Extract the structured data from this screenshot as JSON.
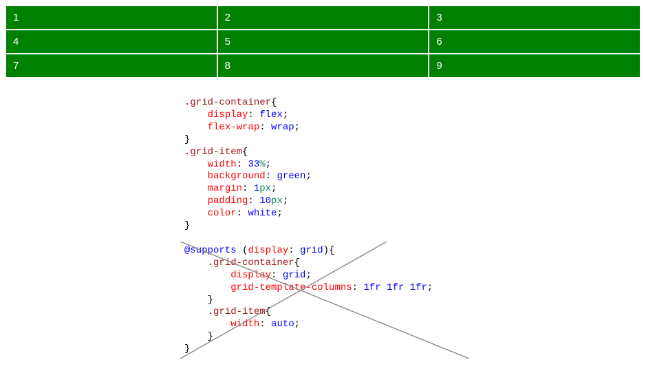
{
  "grid": {
    "cells": [
      "1",
      "2",
      "3",
      "4",
      "5",
      "6",
      "7",
      "8",
      "9"
    ]
  },
  "code": {
    "l1_sel": ".grid-container",
    "l1_t": "{",
    "l2_p": "display",
    "l2_v": "flex",
    "l3_p": "flex-wrap",
    "l3_v": "wrap",
    "l4_t": "}",
    "l5_sel": ".grid-item",
    "l5_t": "{",
    "l6_p": "width",
    "l6_n": "33",
    "l6_u": "%",
    "l7_p": "background",
    "l7_v": "green",
    "l8_p": "margin",
    "l8_n": "1",
    "l8_u": "px",
    "l9_p": "padding",
    "l9_n": "10",
    "l9_u": "px",
    "l10_p": "color",
    "l10_v": "white",
    "l11_t": "}",
    "blank": "",
    "l12_at": "@supports",
    "l12_cp": "display",
    "l12_cv": "grid",
    "l12_t": "{",
    "l13_sel": ".grid-container",
    "l13_t": "{",
    "l14_p": "display",
    "l14_v": "grid",
    "l15_p": "grid-template-columns",
    "l15_v": "1fr 1fr 1fr",
    "l16_t": "}",
    "l17_sel": ".grid-item",
    "l17_t": "{",
    "l18_p": "width",
    "l18_v": "auto",
    "l19_t": "}",
    "l20_t": "}"
  }
}
